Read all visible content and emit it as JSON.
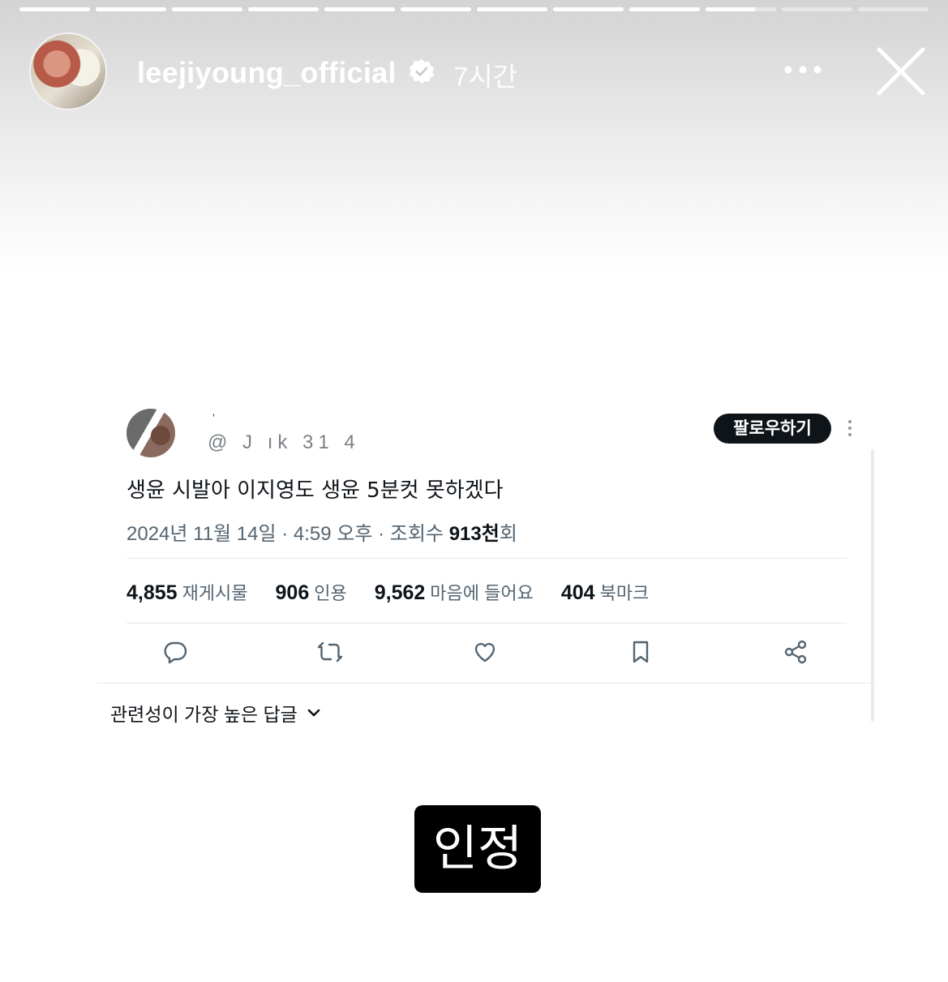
{
  "story": {
    "progress": [
      1,
      1,
      1,
      1,
      1,
      1,
      1,
      1,
      1,
      0.7,
      0,
      0
    ],
    "username": "leejiyoung_official",
    "time_ago": "7시간",
    "icons": {
      "verified": "verified-badge-icon",
      "more": "more-options-icon",
      "close": "close-icon"
    }
  },
  "tweet": {
    "author_name": "ʼ",
    "handle": "@ J ık 31 4",
    "follow_label": "팔로우하기",
    "text": "생윤 시발아 이지영도 생윤 5분컷 못하겠다",
    "meta_date": "2024년 11월 14일 · 4:59 오후 · 조회수 ",
    "meta_views": "913천",
    "meta_suffix": "회",
    "stats": [
      {
        "num": "4,855",
        "label": "재게시물"
      },
      {
        "num": "906",
        "label": "인용"
      },
      {
        "num": "9,562",
        "label": "마음에 들어요"
      },
      {
        "num": "404",
        "label": "북마크"
      }
    ],
    "actions": [
      "reply-icon",
      "retweet-icon",
      "like-icon",
      "bookmark-icon",
      "share-icon"
    ],
    "replies_sort": "관련성이 가장 높은 답글"
  },
  "sticker": {
    "text": "인정"
  }
}
